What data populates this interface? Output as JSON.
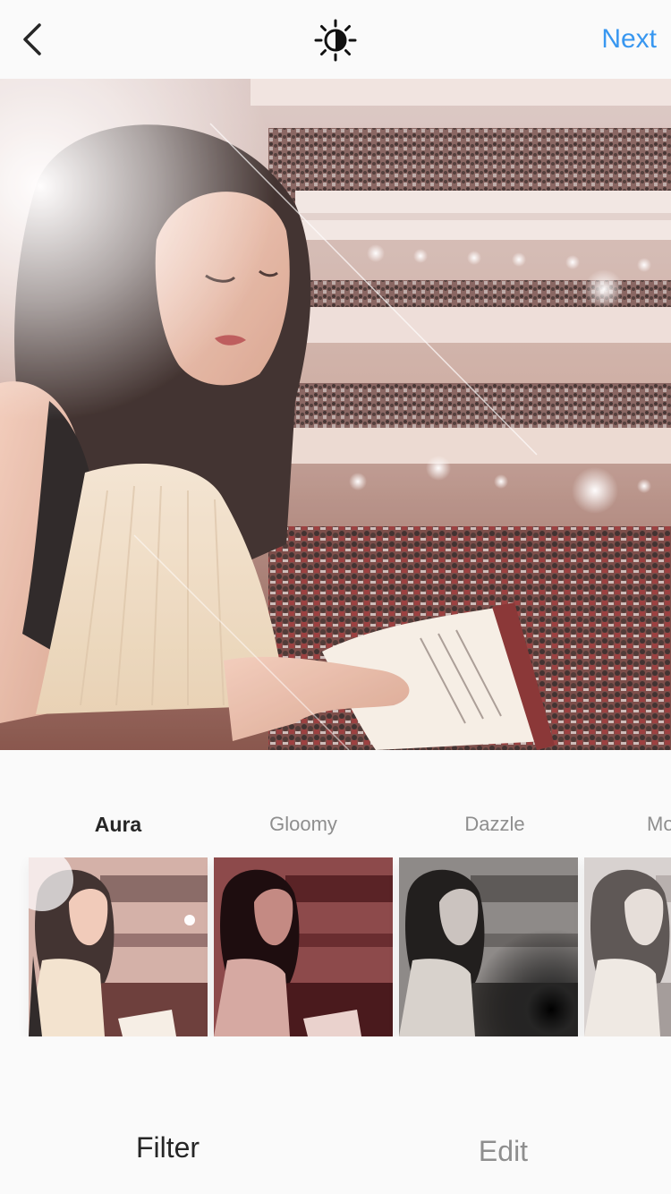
{
  "header": {
    "back_icon": "chevron-left-icon",
    "lux_icon": "lux-sun-icon",
    "next_label": "Next"
  },
  "photo": {
    "subject": "photo-preview"
  },
  "filters": [
    {
      "label": "Aura",
      "active": true
    },
    {
      "label": "Gloomy",
      "active": false
    },
    {
      "label": "Dazzle",
      "active": false
    },
    {
      "label": "Mo",
      "active": false
    }
  ],
  "tabs": {
    "filter_label": "Filter",
    "edit_label": "Edit"
  },
  "colors": {
    "accent": "#3897f0",
    "text_primary": "#262626",
    "text_secondary": "#8e8e8e",
    "background": "#fafafa"
  }
}
